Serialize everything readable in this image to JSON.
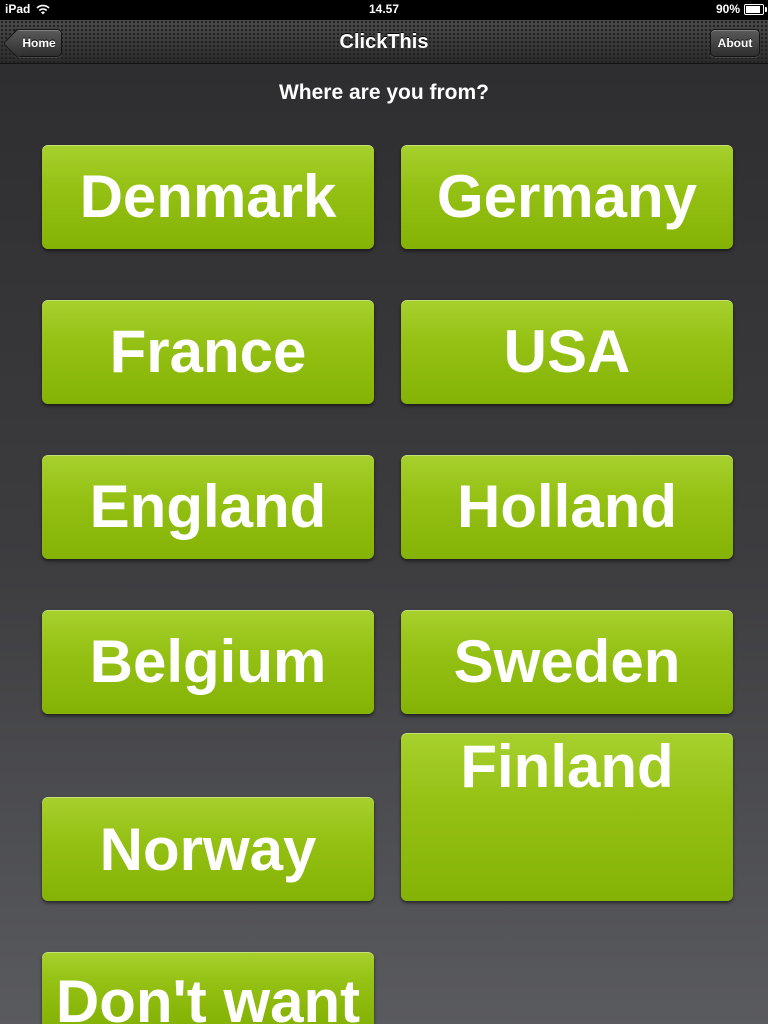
{
  "status_bar": {
    "device": "iPad",
    "time": "14.57",
    "battery_percent": "90%",
    "battery_level": 0.9
  },
  "nav": {
    "title": "ClickThis",
    "home_label": "Home",
    "about_label": "About"
  },
  "question": "Where are you from?",
  "choices": [
    "Denmark",
    "Germany",
    "France",
    "USA",
    "England",
    "Holland",
    "Belgium",
    "Sweden",
    "Norway",
    "Finland",
    "Don't want"
  ],
  "colors": {
    "button_green": "#93c012",
    "background": "#3d3d40"
  }
}
